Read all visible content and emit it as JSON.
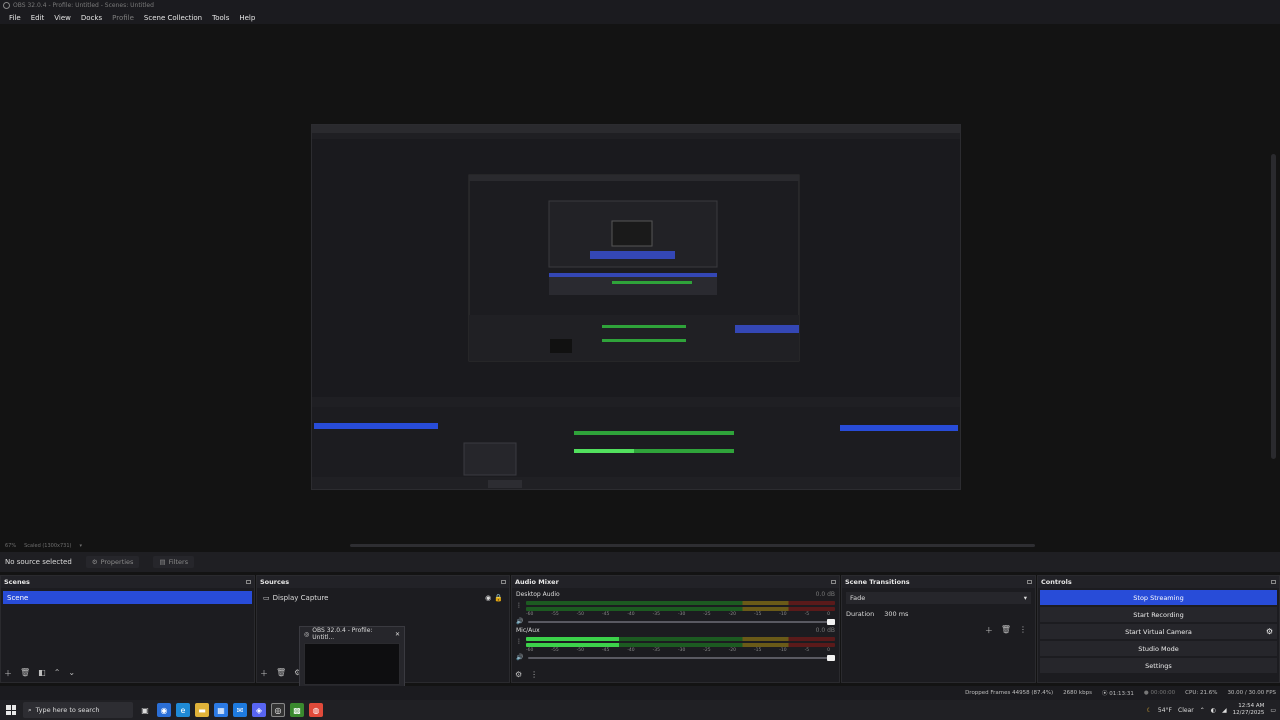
{
  "window": {
    "title": "OBS 32.0.4 - Profile: Untitled - Scenes: Untitled"
  },
  "menu": [
    {
      "label": "File",
      "dim": false
    },
    {
      "label": "Edit",
      "dim": false
    },
    {
      "label": "View",
      "dim": false
    },
    {
      "label": "Docks",
      "dim": false
    },
    {
      "label": "Profile",
      "dim": true
    },
    {
      "label": "Scene Collection",
      "dim": false
    },
    {
      "label": "Tools",
      "dim": false
    },
    {
      "label": "Help",
      "dim": false
    }
  ],
  "preview": {
    "zoom": "67%",
    "scaled": "Scaled (1300x731)"
  },
  "source_bar": {
    "no_source": "No source selected",
    "properties": "Properties",
    "filters": "Filters"
  },
  "scenes": {
    "title": "Scenes",
    "items": [
      "Scene"
    ]
  },
  "sources": {
    "title": "Sources",
    "items": [
      "Display Capture"
    ]
  },
  "mixer": {
    "title": "Audio Mixer",
    "channels": [
      {
        "name": "Desktop Audio",
        "db": "0.0 dB",
        "level": 0.0
      },
      {
        "name": "Mic/Aux",
        "db": "0.0 dB",
        "level": 0.3
      }
    ],
    "scale": [
      "-60",
      "-55",
      "-50",
      "-45",
      "-40",
      "-35",
      "-30",
      "-25",
      "-20",
      "-15",
      "-10",
      "-5",
      "0"
    ]
  },
  "transitions": {
    "title": "Scene Transitions",
    "selected": "Fade",
    "duration_label": "Duration",
    "duration_value": "300 ms"
  },
  "controls": {
    "title": "Controls",
    "buttons": [
      {
        "label": "Stop Streaming",
        "active": true
      },
      {
        "label": "Start Recording",
        "active": false
      },
      {
        "label": "Start Virtual Camera",
        "active": false
      },
      {
        "label": "Studio Mode",
        "active": false
      },
      {
        "label": "Settings",
        "active": false
      }
    ]
  },
  "status": {
    "dropped": "Dropped Frames 44958 (87.4%)",
    "bitrate": "2680 kbps",
    "live_time": "01:13:31",
    "rec_time": "00:00:00",
    "cpu": "CPU: 21.6%",
    "fps": "30.00 / 30.00 FPS"
  },
  "taskbar": {
    "search_placeholder": "Type here to search",
    "weather": "54°F",
    "weather_text": "Clear",
    "time": "12:54 AM",
    "date": "12/27/2025"
  },
  "popup": {
    "title": "OBS 32.0.4 - Profile: Untitl..."
  },
  "colors": {
    "accent": "#284cd8",
    "meter_green": "#3cd24a",
    "background": "#131313"
  }
}
